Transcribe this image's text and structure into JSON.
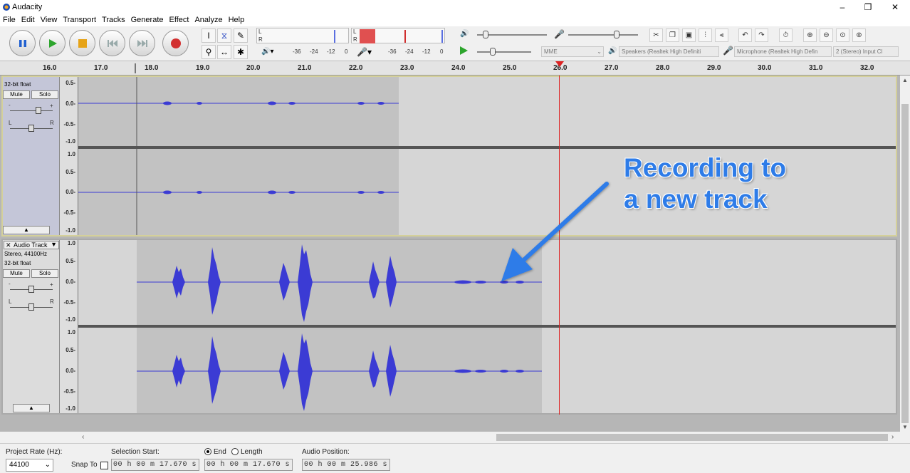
{
  "window": {
    "title": "Audacity",
    "minimize": "–",
    "maximize": "❐",
    "close": "✕"
  },
  "menu": [
    "File",
    "Edit",
    "View",
    "Transport",
    "Tracks",
    "Generate",
    "Effect",
    "Analyze",
    "Help"
  ],
  "meters": {
    "rec_L": "L",
    "rec_R": "R",
    "play_L": "L",
    "play_R": "R",
    "rec_scale": [
      "-36",
      "-24",
      "-12",
      "0"
    ],
    "play_scale": [
      "-36",
      "-24",
      "-12",
      "0"
    ]
  },
  "device": {
    "host": "MME",
    "playback": "Speakers (Realtek High Definiti",
    "recording": "Microphone (Realtek High Defin",
    "channels": "2 (Stereo) Input Cl"
  },
  "ruler_ticks": [
    "16.0",
    "17.0",
    "18.0",
    "19.0",
    "20.0",
    "21.0",
    "22.0",
    "23.0",
    "24.0",
    "25.0",
    "26.0",
    "27.0",
    "28.0",
    "29.0",
    "30.0",
    "31.0",
    "32.0"
  ],
  "track1": {
    "format": "32-bit float",
    "mute": "Mute",
    "solo": "Solo",
    "gain_minus": "-",
    "gain_plus": "+",
    "pan_l": "L",
    "pan_r": "R",
    "scale_top": [
      "0.5-",
      "0.0-",
      "-0.5-",
      "-1.0"
    ],
    "scale_bottom": [
      "1.0",
      "0.5-",
      "0.0-",
      "-0.5-",
      "-1.0"
    ]
  },
  "track2": {
    "name": "Audio Track",
    "close": "✕",
    "format1": "Stereo, 44100Hz",
    "format2": "32-bit float",
    "mute": "Mute",
    "solo": "Solo",
    "gain_minus": "-",
    "gain_plus": "+",
    "pan_l": "L",
    "pan_r": "R",
    "scale_top": [
      "1.0",
      "0.5-",
      "0.0-",
      "-0.5-",
      "-1.0"
    ],
    "scale_bottom": [
      "1.0",
      "0.5-",
      "0.0-",
      "-0.5-",
      "-1.0"
    ]
  },
  "annotation": {
    "line1": "Recording to",
    "line2": "a new track"
  },
  "status": {
    "project_rate_label": "Project Rate (Hz):",
    "project_rate": "44100",
    "snap_to": "Snap To",
    "selection_start_label": "Selection Start:",
    "end_label": "End",
    "length_label": "Length",
    "selection_start": "00 h 00 m 17.670 s",
    "selection_end": "00 h 00 m 17.670 s",
    "audio_position_label": "Audio Position:",
    "audio_position": "00 h 00 m 25.986 s"
  },
  "colors": {
    "waveform": "#3b3bd4",
    "cursor": "#d22",
    "annotation": "#2e7ce8",
    "selected_border": "#d4d09a"
  }
}
